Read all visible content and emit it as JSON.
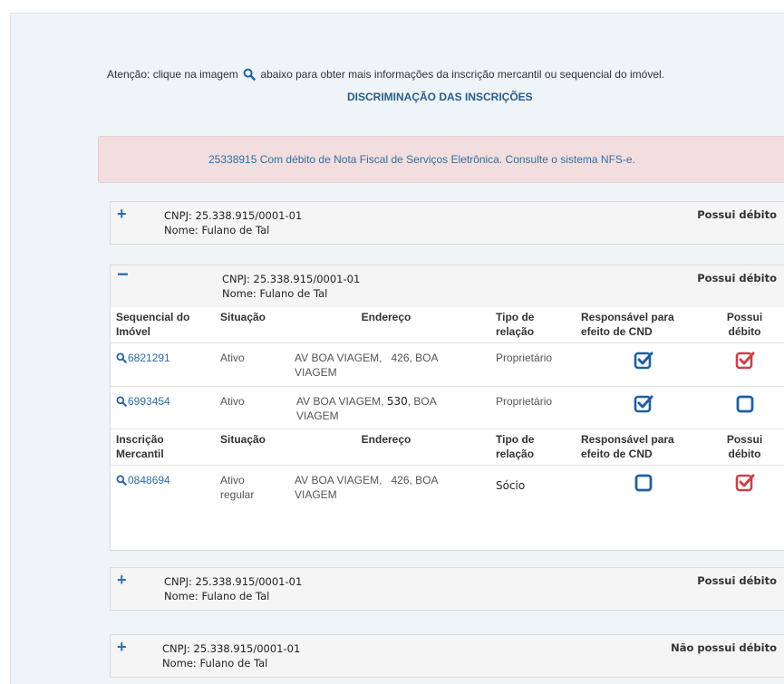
{
  "notice": {
    "prefix": "Atenção: clique na imagem",
    "suffix": "abaixo para obter mais informações da inscrição mercantil ou sequencial do imóvel."
  },
  "section_title": "DISCRIMINAÇÃO DAS INSCRIÇÕES",
  "alert": "25338915 Com débito de Nota Fiscal de Serviços Eletrônica. Consulte o sistema NFS-e.",
  "colors": {
    "link": "#2f6ea5",
    "accent_blue": "#1f5fa0",
    "alert_red": "#c9414a",
    "alert_bg": "#f2dede"
  },
  "cards": [
    {
      "toggle": "+",
      "cnpj_label": "CNPJ:",
      "cnpj": "25.338.915/0001-01",
      "name_label": "Nome:",
      "name": "Fulano de Tal",
      "status": "Possui débito"
    },
    {
      "toggle": "−",
      "cnpj_label": "CNPJ:",
      "cnpj": "25.338.915/0001-01",
      "name_label": "Nome:",
      "name": "Fulano de Tal",
      "status": "Possui débito"
    },
    {
      "toggle": "+",
      "cnpj_label": "CNPJ:",
      "cnpj": "25.338.915/0001-01",
      "name_label": "Nome:",
      "name": "Fulano de Tal",
      "status": "Possui débito"
    },
    {
      "toggle": "+",
      "cnpj_label": "CNPJ:",
      "cnpj": "25.338.915/0001-01",
      "name_label": "Nome:",
      "name": "Fulano de Tal",
      "status": "Não possui débito"
    }
  ],
  "imoveis": {
    "headers": [
      "Sequencial do Imóvel",
      "Situação",
      "Endereço",
      "Tipo de relação",
      "Responsável para efeito de CND",
      "Possui débito"
    ],
    "rows": [
      {
        "id": "6821291",
        "situacao": "Ativo",
        "endereco_a": "AV BOA VIAGEM,   426, BOA",
        "endereco_b": "VIAGEM",
        "tipo": "Proprietário",
        "responsavel": "checked-blue",
        "debito": "checked-red"
      },
      {
        "id": "6993454",
        "situacao": "Ativo",
        "endereco_a": "AV BOA VIAGEM,",
        "endereco_num": "530",
        "endereco_c": ", BOA",
        "endereco_b": "VIAGEM",
        "tipo": "Proprietário",
        "responsavel": "checked-blue",
        "debito": "empty-blue"
      }
    ]
  },
  "mercantil": {
    "headers": [
      "Inscrição Mercantil",
      "Situação",
      "Endereço",
      "Tipo de relação",
      "Responsável para efeito de CND",
      "Possui débito"
    ],
    "rows": [
      {
        "id": "0848694",
        "situacao_a": "Ativo",
        "situacao_b": "regular",
        "endereco_a": "AV BOA VIAGEM,   426, BOA",
        "endereco_b": "VIAGEM",
        "tipo": "Sócio",
        "responsavel": "empty-blue",
        "debito": "checked-red"
      }
    ]
  },
  "icons": [
    "search-icon",
    "plus-icon",
    "minus-icon",
    "checkbox-checked-icon",
    "checkbox-empty-icon"
  ]
}
